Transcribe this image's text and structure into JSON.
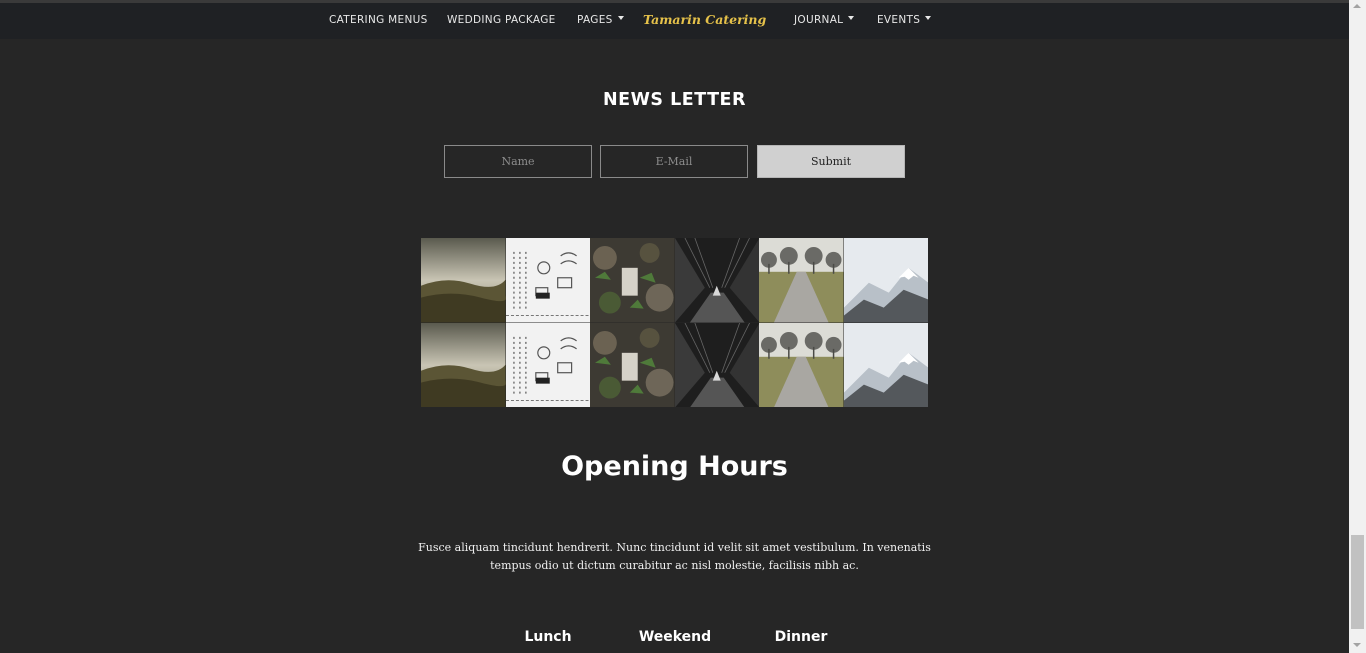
{
  "nav": {
    "left_items": [
      {
        "label": "CATERING MENUS",
        "dropdown": false
      },
      {
        "label": "WEDDING PACKAGE",
        "dropdown": false
      },
      {
        "label": "PAGES",
        "dropdown": true
      }
    ],
    "brand": "Tamarin Catering",
    "right_items": [
      {
        "label": "JOURNAL",
        "dropdown": true
      },
      {
        "label": "EVENTS",
        "dropdown": true
      }
    ]
  },
  "newsletter": {
    "title": "NEWS LETTER",
    "name_placeholder": "Name",
    "email_placeholder": "E-Mail",
    "submit_label": "Submit"
  },
  "gallery": {
    "tiles": [
      "hills-landscape",
      "line-icons-sheet",
      "mossy-stones",
      "dark-forest-road",
      "tree-lined-path",
      "snowy-mountain",
      "hills-landscape",
      "line-icons-sheet",
      "mossy-stones",
      "dark-forest-road",
      "tree-lined-path",
      "snowy-mountain"
    ]
  },
  "opening_hours": {
    "title": "Opening Hours",
    "description": "Fusce aliquam tincidunt hendrerit. Nunc tincidunt id velit sit amet vestibulum. In venenatis tempus odio ut dictum curabitur ac nisl molestie, facilisis nibh ac.",
    "columns": [
      "Lunch",
      "Weekend",
      "Dinner"
    ]
  },
  "colors": {
    "background": "#262626",
    "navbar": "#1f2124",
    "brand": "#e6c24a",
    "submit_bg": "#d0d0d0"
  }
}
